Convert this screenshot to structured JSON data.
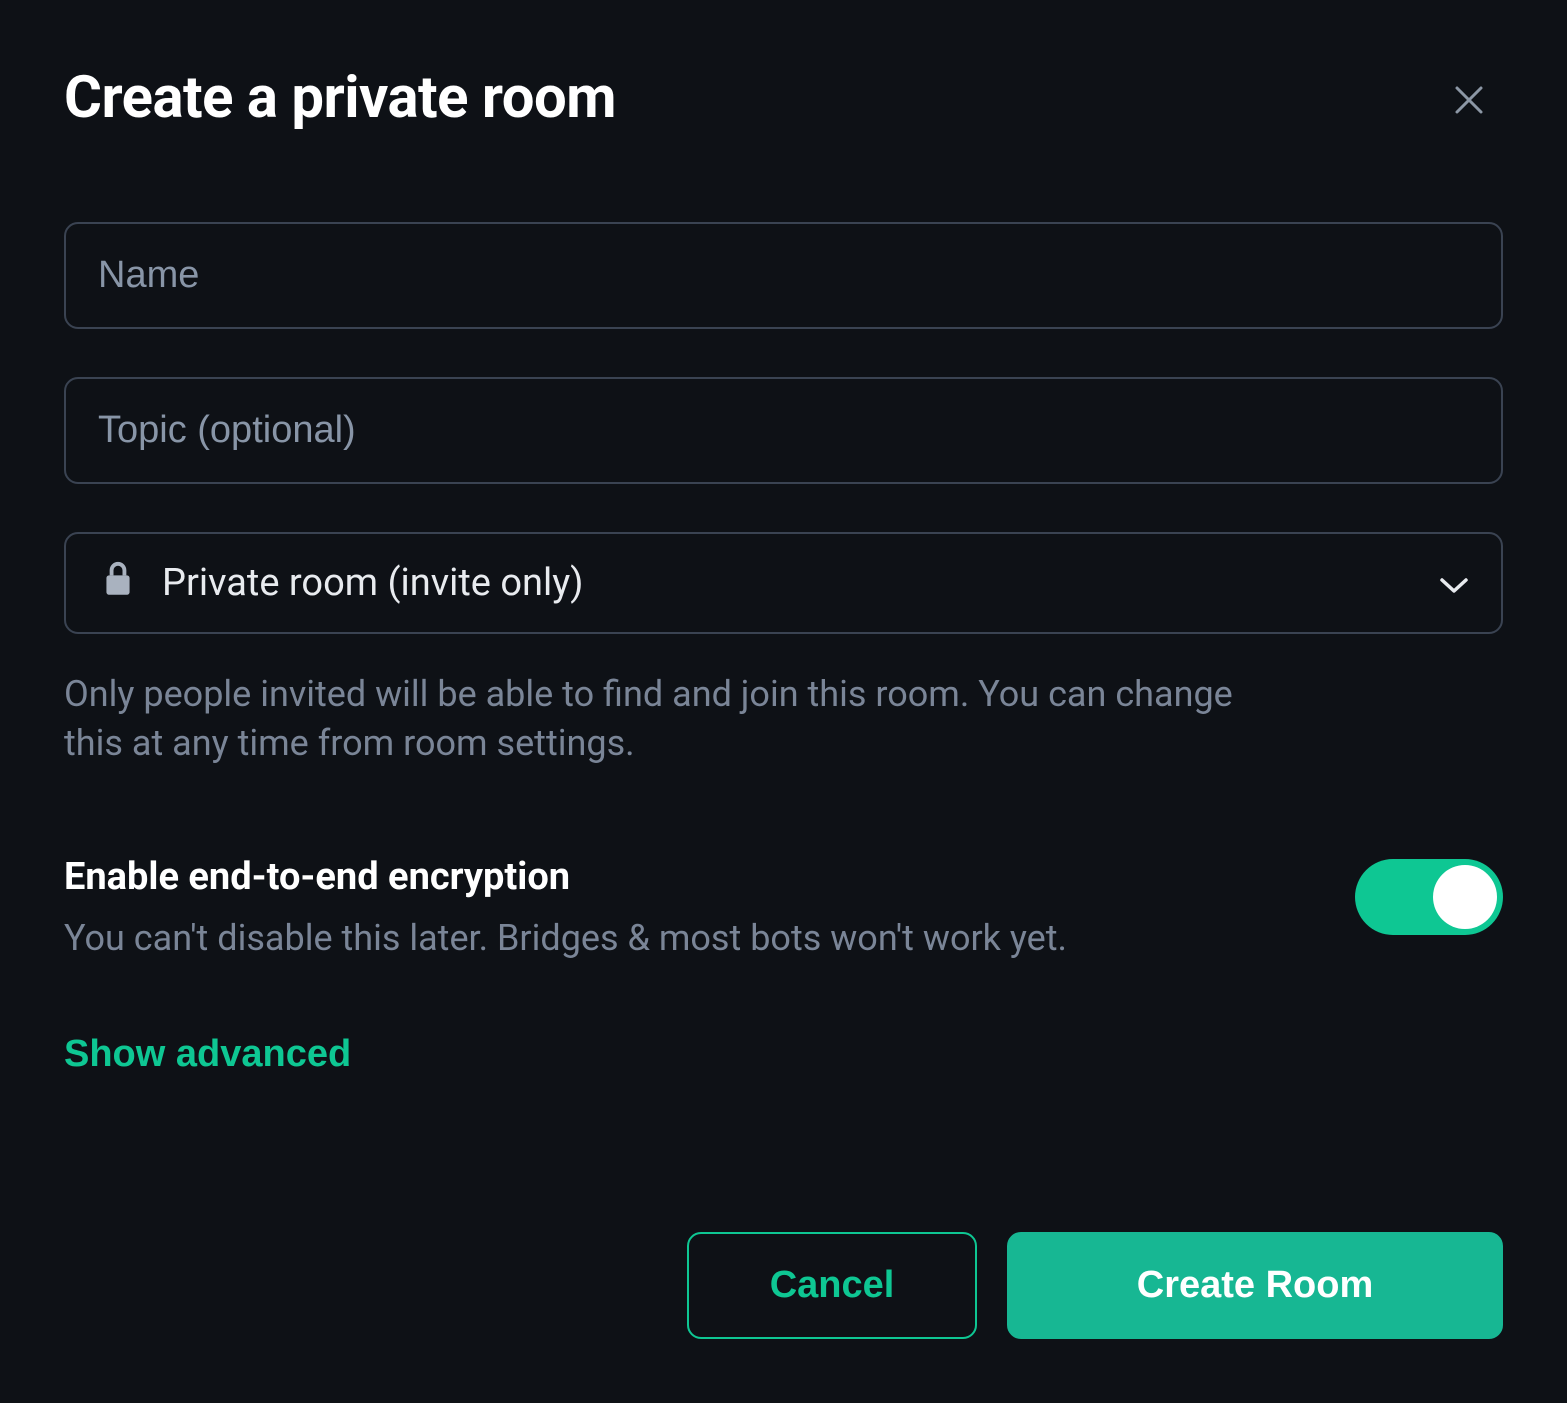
{
  "dialog": {
    "title": "Create a private room"
  },
  "form": {
    "name_placeholder": "Name",
    "topic_placeholder": "Topic (optional)",
    "visibility": {
      "selected": "Private room (invite only)",
      "helper": "Only people invited will be able to find and join this room. You can change this at any time from room settings."
    },
    "encryption": {
      "title": "Enable end-to-end encryption",
      "sub": "You can't disable this later. Bridges & most bots won't work yet.",
      "enabled": true
    },
    "advanced_label": "Show advanced"
  },
  "buttons": {
    "cancel": "Cancel",
    "create": "Create Room"
  },
  "colors": {
    "accent": "#0ec793",
    "bg": "#0e1116",
    "border": "#3a4352",
    "muted": "#7a8597"
  }
}
